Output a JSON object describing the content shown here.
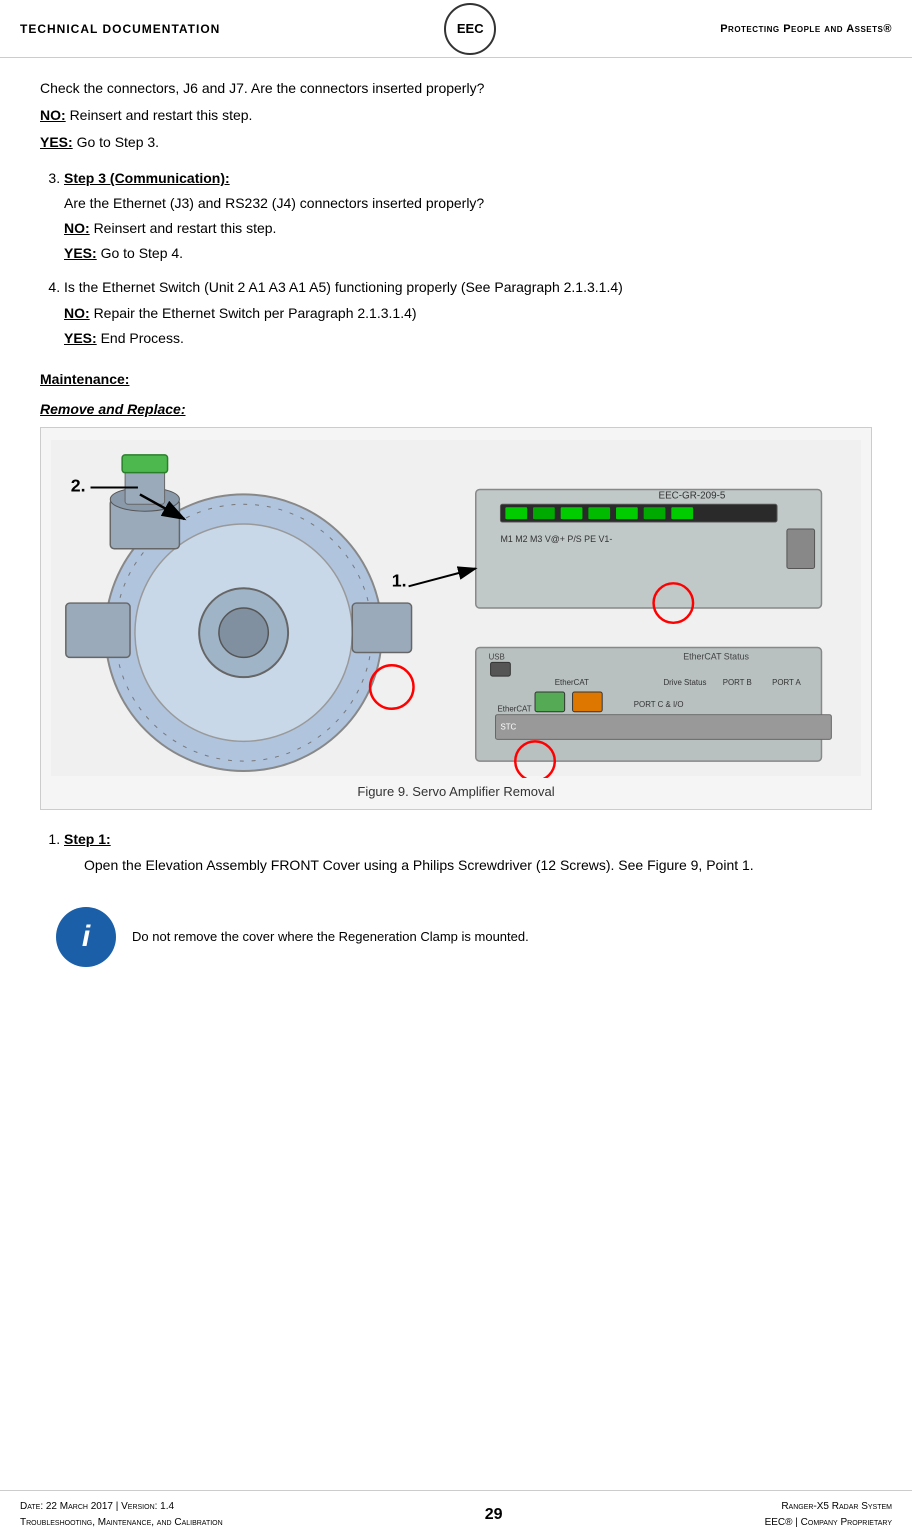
{
  "header": {
    "left": "Technical Documentation",
    "logo": "EEC",
    "right": "Protecting People and Assets®"
  },
  "intro": {
    "check_line": "Check the connectors, J6 and J7.  Are the connectors inserted properly?",
    "no_label": "NO:",
    "no_text": "Reinsert and restart this step.",
    "yes_label": "YES:",
    "yes_text": "Go to Step 3."
  },
  "steps": [
    {
      "number": "3.",
      "title": "Step 3 (Communication):",
      "question": "Are the Ethernet (J3) and RS232 (J4) connectors inserted properly?",
      "no_label": "NO:",
      "no_text": "Reinsert and restart this step.",
      "yes_label": "YES:",
      "yes_text": "Go to Step 4."
    },
    {
      "number": "4.",
      "body": "Is the Ethernet Switch (Unit 2 A1 A3 A1 A5) functioning properly (See Paragraph 2.1.3.1.4)",
      "no_label": "NO:",
      "no_text": "Repair the Ethernet Switch per Paragraph 2.1.3.1.4)",
      "yes_label": "YES:",
      "yes_text": "End Process."
    }
  ],
  "maintenance_header": "Maintenance:",
  "remove_replace_header": "Remove and Replace:",
  "figure": {
    "label1": "1.",
    "label2": "2.",
    "caption": "Figure 9. Servo Amplifier Removal",
    "image_label": "EEC-GR-209-5"
  },
  "step1": {
    "number": "1.",
    "title": "Step 1:",
    "body": "Open the Elevation Assembly FRONT Cover using a Philips Screwdriver (12 Screws). See Figure 9, Point 1."
  },
  "info_note": "Do not remove the cover where the Regeneration Clamp is mounted.",
  "footer": {
    "date_version": "Date: 22 March 2017 | Version: 1.4",
    "doc_type": "Troubleshooting, Maintenance, and Calibration",
    "page_number": "29",
    "system": "Ranger-X5 Radar System",
    "proprietary": "EEC® | Company Proprietary"
  }
}
